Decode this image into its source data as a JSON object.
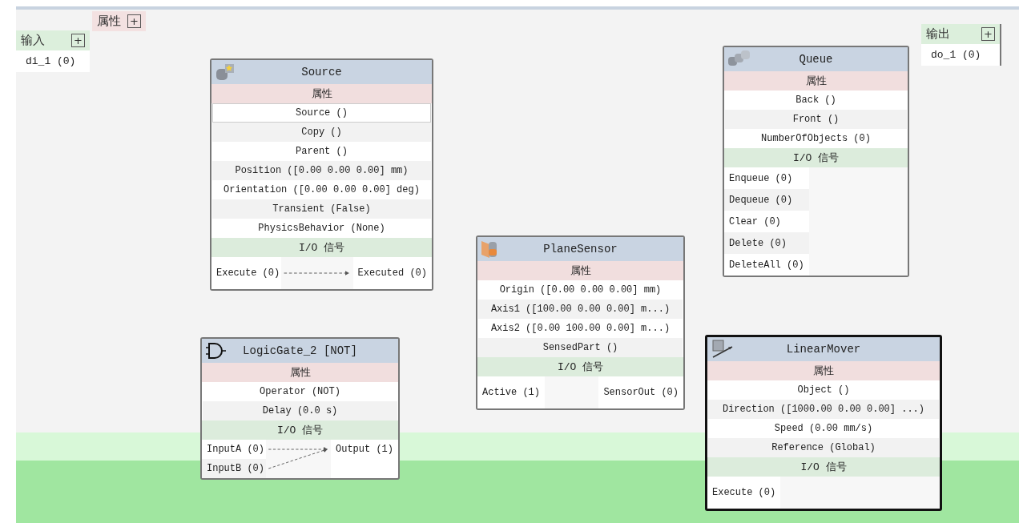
{
  "properties_panel": {
    "title": "属性",
    "add": "+"
  },
  "inputs_panel": {
    "title": "输入",
    "add": "+",
    "items": [
      "di_1 (0)"
    ]
  },
  "outputs_panel": {
    "title": "输出",
    "add": "+",
    "items": [
      "do_1 (0)"
    ]
  },
  "nodes": [
    {
      "kind": "source",
      "title": "Source",
      "selected": false,
      "props_title": "属性",
      "io_title": "I/O 信号",
      "props": [
        {
          "text": "Source ()",
          "selected": true
        },
        {
          "text": "Copy ()",
          "selected": false
        },
        {
          "text": "Parent ()",
          "selected": false
        },
        {
          "text": "Position ([0.00 0.00 0.00] mm)",
          "selected": false
        },
        {
          "text": "Orientation ([0.00 0.00 0.00] deg)",
          "selected": false
        },
        {
          "text": "Transient (False)",
          "selected": false
        },
        {
          "text": "PhysicsBehavior (None)",
          "selected": false
        }
      ],
      "inputs": [
        {
          "text": "Execute (0)",
          "linked": true
        }
      ],
      "outputs": [
        "Executed (0)"
      ]
    },
    {
      "kind": "queue",
      "title": "Queue",
      "selected": false,
      "props_title": "属性",
      "io_title": "I/O 信号",
      "props": [
        {
          "text": "Back ()",
          "selected": false
        },
        {
          "text": "Front ()",
          "selected": false
        },
        {
          "text": "NumberOfObjects (0)",
          "selected": false
        }
      ],
      "inputs": [
        {
          "text": "Enqueue (0)",
          "linked": false
        },
        {
          "text": "Dequeue (0)",
          "linked": false
        },
        {
          "text": "Clear (0)",
          "linked": false
        },
        {
          "text": "Delete (0)",
          "linked": false
        },
        {
          "text": "DeleteAll (0)",
          "linked": false
        }
      ]
    },
    {
      "kind": "sensor",
      "title": "PlaneSensor",
      "selected": false,
      "props_title": "属性",
      "io_title": "I/O 信号",
      "props": [
        {
          "text": "Origin ([0.00 0.00 0.00] mm)",
          "selected": false
        },
        {
          "text": "Axis1 ([100.00 0.00 0.00] m...)",
          "selected": false
        },
        {
          "text": "Axis2 ([0.00 100.00 0.00] m...)",
          "selected": false
        },
        {
          "text": "SensedPart ()",
          "selected": false
        }
      ],
      "inputs": [
        {
          "text": "Active (1)",
          "linked": false
        }
      ],
      "outputs": [
        "SensorOut (0)"
      ]
    },
    {
      "kind": "gate",
      "title": "LogicGate_2 [NOT]",
      "selected": false,
      "props_title": "属性",
      "io_title": "I/O 信号",
      "props": [
        {
          "text": "Operator (NOT)",
          "selected": false
        },
        {
          "text": "Delay (0.0 s)",
          "selected": false
        }
      ],
      "inputs": [
        {
          "text": "InputA (0)",
          "linked": true
        },
        {
          "text": "InputB (0)",
          "linked": true
        }
      ],
      "outputs": [
        "Output (1)"
      ]
    },
    {
      "kind": "mover",
      "title": "LinearMover",
      "selected": true,
      "props_title": "属性",
      "io_title": "I/O 信号",
      "props": [
        {
          "text": "Object ()",
          "selected": false
        },
        {
          "text": "Direction ([1000.00 0.00 0.00] ...)",
          "selected": false
        },
        {
          "text": "Speed (0.00 mm/s)",
          "selected": false
        },
        {
          "text": "Reference (Global)",
          "selected": false
        }
      ],
      "inputs": [
        {
          "text": "Execute (0)",
          "linked": false
        }
      ]
    }
  ]
}
